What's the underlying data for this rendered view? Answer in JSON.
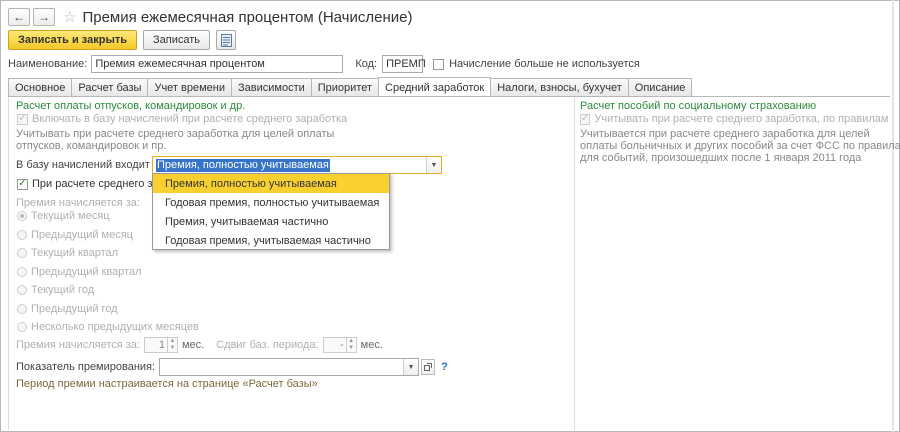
{
  "window": {
    "title": "Премия ежемесячная процентом (Начисление)"
  },
  "nav": {
    "back": "←",
    "forward": "→",
    "favorite": "☆"
  },
  "toolbar": {
    "save_close": "Записать и закрыть",
    "save": "Записать"
  },
  "form": {
    "name_label": "Наименование:",
    "name_value": "Премия ежемесячная процентом",
    "code_label": "Код:",
    "code_value": "ПРЕМП",
    "unused_label": "Начисление больше не используется"
  },
  "tabs": [
    "Основное",
    "Расчет базы",
    "Учет времени",
    "Зависимости",
    "Приоритет",
    "Средний заработок",
    "Налоги, взносы, бухучет",
    "Описание"
  ],
  "left": {
    "section_title": "Расчет оплаты отпусков, командировок и др.",
    "include_base_label": "Включать в базу начислений при расчете среднего заработка",
    "desc_line1": "Учитывать при расчете среднего заработка для целей оплаты",
    "desc_line2": "отпусков, командировок и пр.",
    "base_label": "В базу начислений входит как:",
    "base_value": "Премия, полностью учитываемая",
    "avg_calc_label": "При расчете среднего зараб",
    "period_title": "Премия начисляется за:",
    "periods": [
      "Текущий месяц",
      "Предыдущий месяц",
      "Текущий квартал",
      "Предыдущий квартал",
      "Текущий год",
      "Предыдущий год",
      "Несколько предыдущих месяцев"
    ],
    "accrued_for_label": "Премия начисляется за:",
    "accrued_for_value": "1",
    "months_label": "мес.",
    "shift_label": "Сдвиг баз. периода:",
    "shift_value": "-",
    "shift_months_label": "мес.",
    "indicator_label": "Показатель премирования:",
    "indicator_help": "?",
    "note": "Период премии настраивается на странице «Расчет базы»"
  },
  "dropdown_options": [
    "Премия, полностью учитываемая",
    "Годовая премия, полностью учитываемая",
    "Премия, учитываемая частично",
    "Годовая премия, учитываемая частично"
  ],
  "right": {
    "section_title": "Расчет пособий по социальному страхованию",
    "include_label": "Учитывать при расчете среднего заработка, по правилам для событи",
    "desc_line1": "Учитывается при расчете среднего заработка для целей",
    "desc_line2": "оплаты больничных и других пособий за счет ФСС по правилам",
    "desc_line3": "для событий, произошедших после 1 января 2011 года"
  }
}
